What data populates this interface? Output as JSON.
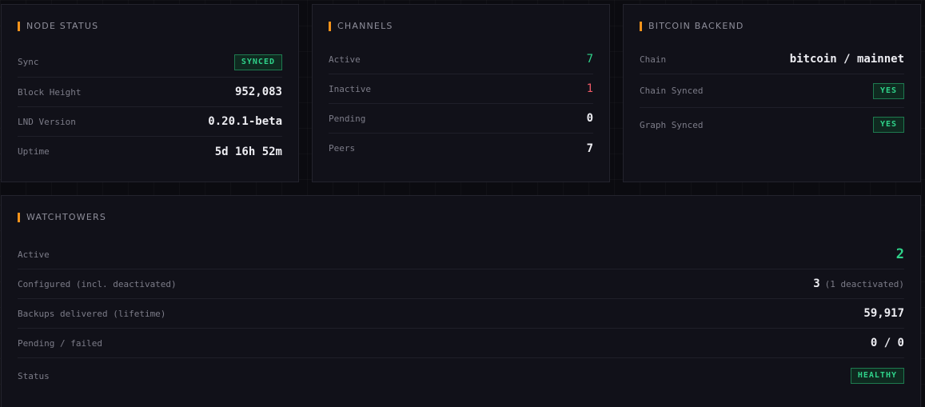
{
  "node_status": {
    "title": "NODE STATUS",
    "sync_label": "Sync",
    "sync_badge": "SYNCED",
    "block_height_label": "Block Height",
    "block_height": "952,083",
    "lnd_version_label": "LND Version",
    "lnd_version": "0.20.1-beta",
    "uptime_label": "Uptime",
    "uptime": "5d 16h 52m"
  },
  "channels": {
    "title": "CHANNELS",
    "active_label": "Active",
    "active": "7",
    "inactive_label": "Inactive",
    "inactive": "1",
    "pending_label": "Pending",
    "pending": "0",
    "peers_label": "Peers",
    "peers": "7"
  },
  "bitcoin_backend": {
    "title": "BITCOIN BACKEND",
    "chain_label": "Chain",
    "chain": "bitcoin / mainnet",
    "chain_synced_label": "Chain Synced",
    "chain_synced_badge": "YES",
    "graph_synced_label": "Graph Synced",
    "graph_synced_badge": "YES"
  },
  "watchtowers": {
    "title": "WATCHTOWERS",
    "active_label": "Active",
    "active": "2",
    "configured_label": "Configured (incl. deactivated)",
    "configured": "3",
    "configured_note": "(1 deactivated)",
    "backups_label": "Backups delivered (lifetime)",
    "backups": "59,917",
    "pending_failed_label": "Pending / failed",
    "pending_failed": "0 / 0",
    "status_label": "Status",
    "status_badge": "HEALTHY"
  },
  "colors": {
    "accent": "#f7931a",
    "success": "#2fd38a",
    "danger": "#ef5a67"
  }
}
